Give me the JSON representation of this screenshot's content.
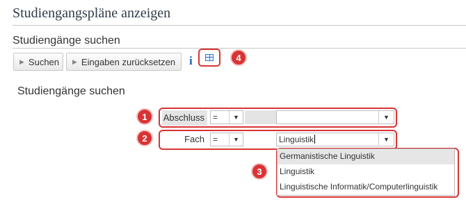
{
  "header": {
    "title": "Studiengangspläne anzeigen",
    "section_title": "Studiengänge suchen"
  },
  "toolbar": {
    "search_label": "Suchen",
    "reset_label": "Eingaben zurücksetzen",
    "info_label": "i"
  },
  "form": {
    "title": "Studiengänge suchen",
    "rows": [
      {
        "label": "Abschluss",
        "operator": "=",
        "value": ""
      },
      {
        "label": "Fach",
        "operator": "=",
        "value": "Linguistik"
      }
    ]
  },
  "dropdown": {
    "options": [
      "Germanistische Linguistik",
      "Linguistik",
      "Linguistische Informatik/Computerlinguistik"
    ],
    "highlighted_index": 0
  },
  "annotations": [
    "1",
    "2",
    "3",
    "4"
  ],
  "colors": {
    "annotation": "#d93333",
    "info": "#1b63b8"
  }
}
